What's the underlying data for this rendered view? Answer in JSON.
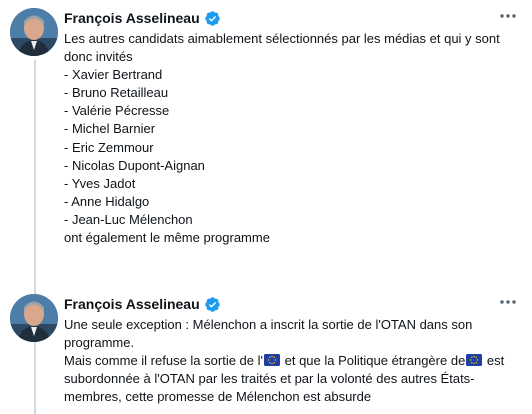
{
  "tweets": [
    {
      "author": "François Asselineau",
      "verified_icon": "verified-badge-icon",
      "more_icon": "more-options-icon",
      "lines": [
        "Les autres candidats aimablement sélectionnés par les médias et qui y sont",
        "donc invités",
        "- Xavier Bertrand",
        "- Bruno Retailleau",
        "- Valérie Pécresse",
        "- Michel Barnier",
        "- Eric Zemmour",
        "- Nicolas Dupont-Aignan",
        "- Yves Jadot",
        "- Anne Hidalgo",
        "- Jean-Luc Mélenchon",
        "ont également le même programme"
      ]
    },
    {
      "author": "François Asselineau",
      "verified_icon": "verified-badge-icon",
      "more_icon": "more-options-icon",
      "lines": [
        "Une seule exception : Mélenchon a inscrit la sortie de l'OTAN dans son",
        "programme."
      ],
      "line3": {
        "part1": "Mais comme il refuse la sortie de l'",
        "part2": " et que la Politique étrangère de",
        "part3": " est"
      },
      "lines_after": [
        "subordonnée à l'OTAN par les traités et par la volonté des autres États-",
        "membres, cette promesse de Mélenchon est absurde"
      ],
      "flag_icon": "eu-flag-emoji-icon"
    }
  ],
  "colors": {
    "text": "#0f1419",
    "secondary": "#536471",
    "verified": "#1d9bf0",
    "thread_line": "#cfd9de"
  }
}
